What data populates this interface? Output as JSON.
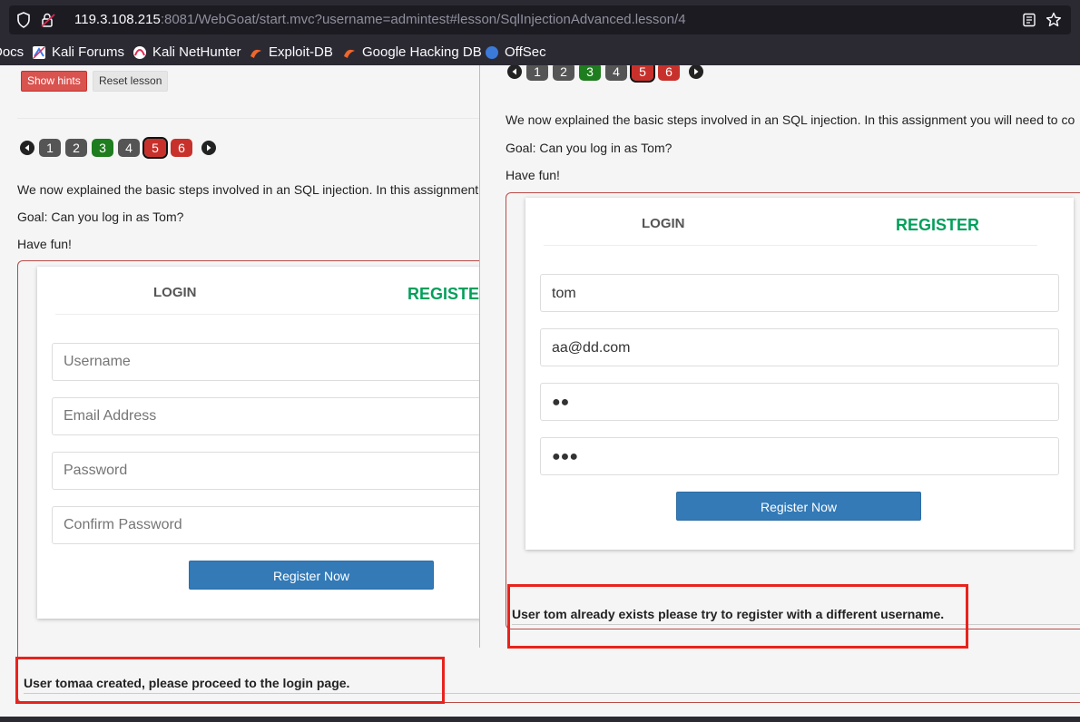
{
  "browser": {
    "url_host": "119.3.108.215",
    "url_rest": ":8081/WebGoat/start.mvc?username=admintest#lesson/SqlInjectionAdvanced.lesson/4",
    "bookmarks": [
      {
        "label": "Docs"
      },
      {
        "label": "Kali Forums"
      },
      {
        "label": "Kali NetHunter"
      },
      {
        "label": "Exploit-DB"
      },
      {
        "label": "Google Hacking DB"
      },
      {
        "label": "OffSec"
      }
    ]
  },
  "toolbar": {
    "show_hints": "Show hints",
    "reset_lesson": "Reset lesson"
  },
  "pager": {
    "pages": [
      "1",
      "2",
      "3",
      "4",
      "5",
      "6"
    ],
    "current": "5"
  },
  "lesson": {
    "intro": "We now explained the basic steps involved in an SQL injection. In this assignment you will need to co",
    "goal": "Goal: Can you log in as Tom?",
    "fun": "Have fun!"
  },
  "form": {
    "tab_login": "LOGIN",
    "tab_register": "REGISTER",
    "username_placeholder": "Username",
    "email_placeholder": "Email Address",
    "password_placeholder": "Password",
    "confirm_placeholder": "Confirm Password",
    "register_button": "Register Now"
  },
  "main_feedback": "User tomaa created, please proceed to the login page.",
  "overlay": {
    "username_value": "tom",
    "email_value": "aa@dd.com",
    "password_value": "●●",
    "confirm_value": "●●●",
    "feedback": "User tom already exists please try to register with a different username."
  },
  "colors": {
    "register_tab": "#029f5b",
    "register_button": "#337ab7",
    "highlight_box": "#e8231d",
    "hints_button": "#d9534f"
  }
}
